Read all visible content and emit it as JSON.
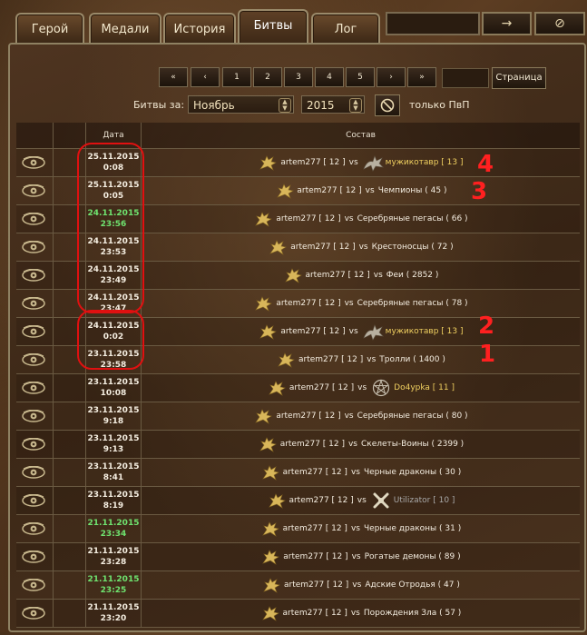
{
  "tabs": [
    "Герой",
    "Медали",
    "История",
    "Битвы",
    "Лог"
  ],
  "active_tab": "Битвы",
  "top_arrow_icon": "→",
  "top_ban_icon": "⊘",
  "pager": [
    "«",
    "‹",
    "1",
    "2",
    "3",
    "4",
    "5",
    "›",
    "»"
  ],
  "page_button": "Страница",
  "filter": {
    "label": "Битвы за:",
    "month": "Ноябрь",
    "year": "2015",
    "pvp_label": "только ПвП"
  },
  "table": {
    "header_date": "Дата",
    "header_comp": "Состав",
    "rows": [
      {
        "date": "25.11.2015",
        "time": "0:08",
        "green": false,
        "player": "artem277 [ 12 ]",
        "opp": "мужикотавр [ 13 ]",
        "style": "gold",
        "icon": "dragon"
      },
      {
        "date": "25.11.2015",
        "time": "0:05",
        "green": false,
        "player": "artem277 [ 12 ]",
        "opp": "Чемпионы ( 45 )",
        "style": "white",
        "icon": ""
      },
      {
        "date": "24.11.2015",
        "time": "23:56",
        "green": true,
        "player": "artem277 [ 12 ]",
        "opp": "Серебряные пегасы ( 66 )",
        "style": "white",
        "icon": ""
      },
      {
        "date": "24.11.2015",
        "time": "23:53",
        "green": false,
        "player": "artem277 [ 12 ]",
        "opp": "Крестоносцы ( 72 )",
        "style": "white",
        "icon": ""
      },
      {
        "date": "24.11.2015",
        "time": "23:49",
        "green": false,
        "player": "artem277 [ 12 ]",
        "opp": "Феи ( 2852 )",
        "style": "white",
        "icon": ""
      },
      {
        "date": "24.11.2015",
        "time": "23:47",
        "green": false,
        "player": "artem277 [ 12 ]",
        "opp": "Серебряные пегасы ( 78 )",
        "style": "white",
        "icon": ""
      },
      {
        "date": "24.11.2015",
        "time": "0:02",
        "green": false,
        "player": "artem277 [ 12 ]",
        "opp": "мужикотавр [ 13 ]",
        "style": "gold",
        "icon": "dragon"
      },
      {
        "date": "23.11.2015",
        "time": "23:58",
        "green": false,
        "player": "artem277 [ 12 ]",
        "opp": "Тролли ( 1400 )",
        "style": "white",
        "icon": ""
      },
      {
        "date": "23.11.2015",
        "time": "10:08",
        "green": false,
        "player": "artem277 [ 12 ]",
        "opp": "Do4ypka [ 11 ]",
        "style": "gold",
        "icon": "pentagram"
      },
      {
        "date": "23.11.2015",
        "time": "9:18",
        "green": false,
        "player": "artem277 [ 12 ]",
        "opp": "Серебряные пегасы ( 80 )",
        "style": "white",
        "icon": ""
      },
      {
        "date": "23.11.2015",
        "time": "9:13",
        "green": false,
        "player": "artem277 [ 12 ]",
        "opp": "Скелеты-Воины ( 2399 )",
        "style": "white",
        "icon": ""
      },
      {
        "date": "23.11.2015",
        "time": "8:41",
        "green": false,
        "player": "artem277 [ 12 ]",
        "opp": "Черные драконы ( 30 )",
        "style": "white",
        "icon": ""
      },
      {
        "date": "23.11.2015",
        "time": "8:19",
        "green": false,
        "player": "artem277 [ 12 ]",
        "opp": "Utilizator [ 10 ]",
        "style": "gray",
        "icon": "bones"
      },
      {
        "date": "21.11.2015",
        "time": "23:34",
        "green": true,
        "player": "artem277 [ 12 ]",
        "opp": "Черные драконы ( 31 )",
        "style": "white",
        "icon": ""
      },
      {
        "date": "21.11.2015",
        "time": "23:28",
        "green": false,
        "player": "artem277 [ 12 ]",
        "opp": "Рогатые демоны ( 89 )",
        "style": "white",
        "icon": ""
      },
      {
        "date": "21.11.2015",
        "time": "23:25",
        "green": true,
        "player": "artem277 [ 12 ]",
        "opp": "Адские Отродья ( 47 )",
        "style": "white",
        "icon": ""
      },
      {
        "date": "21.11.2015",
        "time": "23:20",
        "green": false,
        "player": "artem277 [ 12 ]",
        "opp": "Порождения Зла ( 57 )",
        "style": "white",
        "icon": ""
      }
    ]
  },
  "annotations": [
    "4",
    "3",
    "2",
    "1"
  ],
  "colors": {
    "green_time": "#6fe36f",
    "gold_name": "#f0d060",
    "annotation_red": "#e01010"
  }
}
